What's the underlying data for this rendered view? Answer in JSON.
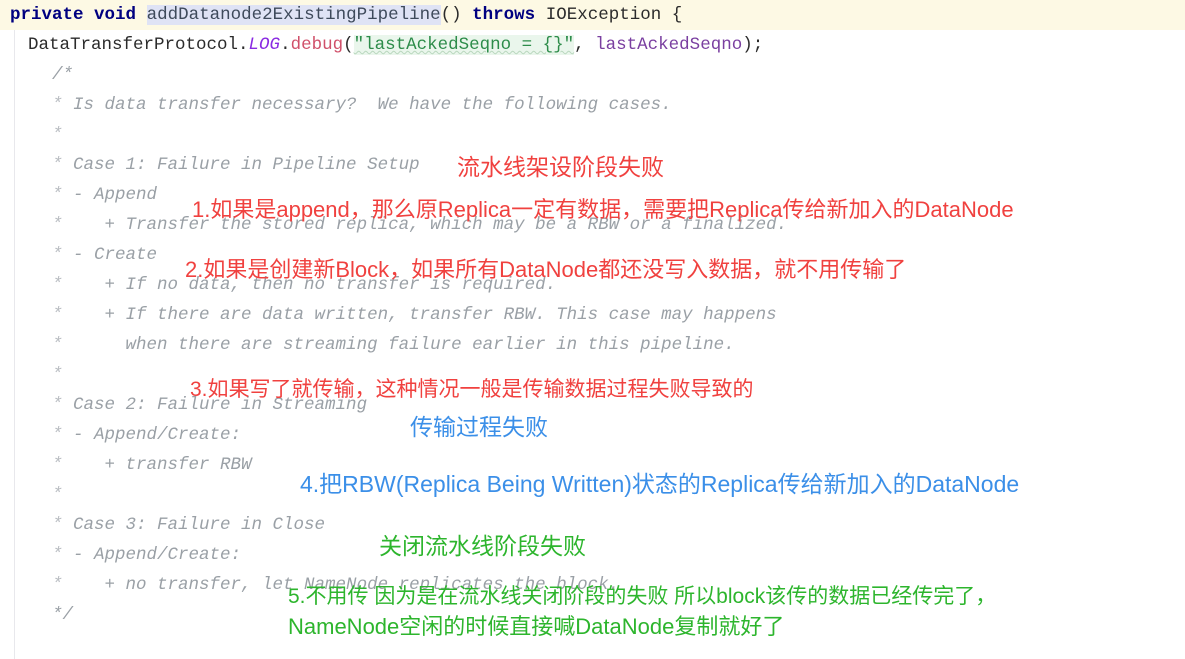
{
  "editor": {
    "language": "java",
    "current_line_highlight": "#fdf9e4",
    "background": "#ffffff"
  },
  "colors": {
    "keyword": "#000080",
    "method_name_highlight_bg": "#dfe3f5",
    "string": "#2d8c4a",
    "method_call": "#d0506a",
    "field_static": "#8a2be2",
    "comment": "#9aa0a6",
    "annotation_red": "#f0413f",
    "annotation_blue": "#3b8fe8",
    "annotation_green": "#2db52d"
  },
  "code": {
    "signature": {
      "kw_private": "private",
      "kw_void": "void",
      "method_name": "addDatanode2ExistingPipeline",
      "parens": "()",
      "kw_throws": "throws",
      "exception": "IOException",
      "brace": "{"
    },
    "log_line": {
      "qualifier": "DataTransferProtocol.",
      "field": "LOG",
      "dot": ".",
      "method": "debug",
      "open_paren": "(",
      "string": "\"lastAckedSeqno = {}\"",
      "comma": ", ",
      "arg": "lastAckedSeqno",
      "close": ");"
    },
    "comment_open": "/*",
    "comment_close": "*/",
    "comment_lines": [
      {
        "star": "*",
        "text": " Is data transfer necessary?  We have the following cases."
      },
      {
        "star": "*",
        "text": ""
      },
      {
        "star": "*",
        "text": " Case 1: Failure in Pipeline Setup"
      },
      {
        "star": "*",
        "text": " - Append"
      },
      {
        "star": "*",
        "text": "    + Transfer the stored replica, which may be a RBW or a finalized."
      },
      {
        "star": "*",
        "text": " - Create"
      },
      {
        "star": "*",
        "text": "    + If no data, then no transfer is required."
      },
      {
        "star": "*",
        "text": "    + If there are data written, transfer RBW. This case may happens"
      },
      {
        "star": "*",
        "text": "      when there are streaming failure earlier in this pipeline."
      },
      {
        "star": "*",
        "text": ""
      },
      {
        "star": "*",
        "text": " Case 2: Failure in Streaming"
      },
      {
        "star": "*",
        "text": " - Append/Create:"
      },
      {
        "star": "*",
        "text": "    + transfer RBW"
      },
      {
        "star": "*",
        "text": ""
      },
      {
        "star": "*",
        "text": " Case 3: Failure in Close"
      },
      {
        "star": "*",
        "text": " - Append/Create:"
      },
      {
        "star": "*",
        "text": "    + no transfer, let NameNode replicates the block."
      }
    ]
  },
  "annotations": [
    {
      "id": "case1-label",
      "color": "red",
      "text": "流水线架设阶段失败"
    },
    {
      "id": "note-1",
      "color": "red",
      "text": "1.如果是append，那么原Replica一定有数据，需要把Replica传给新加入的DataNode"
    },
    {
      "id": "note-2",
      "color": "red",
      "text": "2.如果是创建新Block，如果所有DataNode都还没写入数据，就不用传输了"
    },
    {
      "id": "note-3",
      "color": "red",
      "text": "3.如果写了就传输，这种情况一般是传输数据过程失败导致的"
    },
    {
      "id": "case2-label",
      "color": "blue",
      "text": "传输过程失败"
    },
    {
      "id": "note-4",
      "color": "blue",
      "text": "4.把RBW(Replica Being Written)状态的Replica传给新加入的DataNode"
    },
    {
      "id": "case3-label",
      "color": "green",
      "text": "关闭流水线阶段失败"
    },
    {
      "id": "note-5a",
      "color": "green",
      "text": "5.不用传 因为是在流水线关闭阶段的失败 所以block该传的数据已经传完了，"
    },
    {
      "id": "note-5b",
      "color": "green",
      "text": "NameNode空闲的时候直接喊DataNode复制就好了"
    }
  ]
}
